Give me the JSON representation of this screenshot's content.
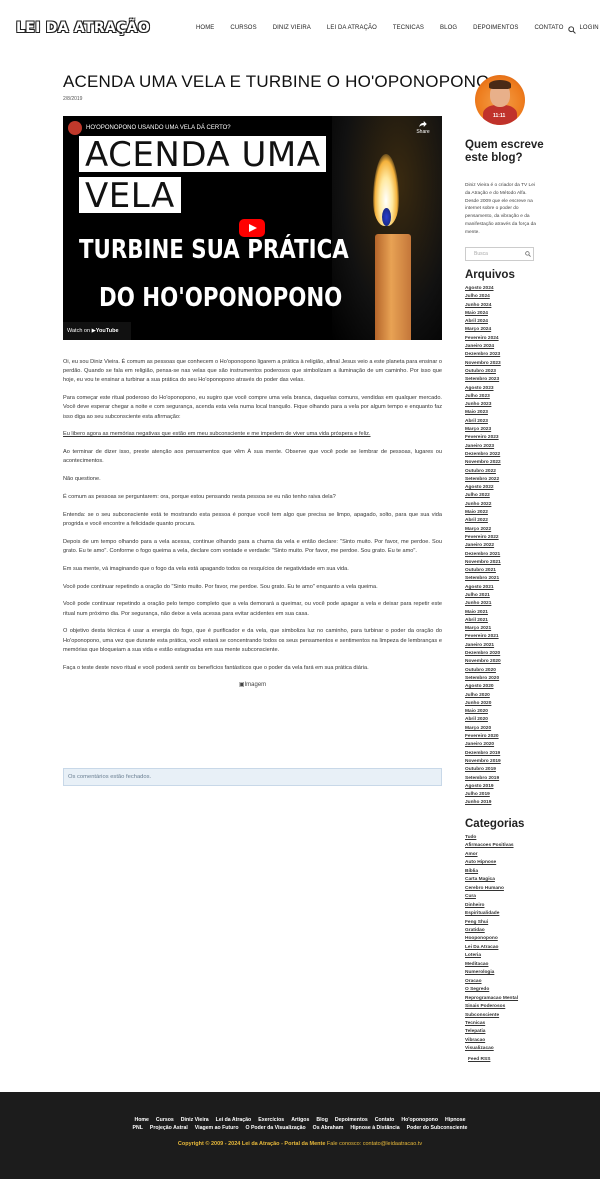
{
  "header": {
    "logo": "LEI DA ATRAÇÃO",
    "nav": [
      "HOME",
      "CURSOS",
      "DINIZ VIEIRA",
      "LEI DA ATRAÇÃO",
      "TECNICAS",
      "BLOG",
      "DEPOIMENTOS",
      "CONTATO",
      "LOGIN"
    ]
  },
  "post": {
    "title": "ACENDA UMA VELA E TURBINE O HO'OPONOPONO",
    "date": "2/8/2019"
  },
  "video": {
    "title": "HO'OPONOPONO USANDO UMA VELA DÁ CERTO?",
    "share": "Share",
    "line1": "ACENDA UMA",
    "line2": "VELA",
    "line3": "TURBINE SUA PRÁTICA",
    "line4": "DO HO'OPONOPONO",
    "watch_on": "Watch on",
    "youtube": "YouTube"
  },
  "article": {
    "paragraphs": [
      "Oi, eu sou Diniz Vieira. É comum as pessoas que conhecem o Ho'oponopono ligarem a prática à religião, afinal Jesus veio a este planeta para ensinar o perdão. Quando se fala em religião, pensa-se nas velas que são instrumentos poderosos que simbolizam a iluminação de um caminho. Por isso que hoje, eu vou te ensinar a turbinar a sua prática do seu Ho'oponopono através do poder das velas.",
      "Para começar este ritual poderoso do Ho'oponopono, eu sugiro que você compre uma vela branca, daquelas comuns, vendidas em qualquer mercado. Você deve esperar chegar a noite e com segurança, acenda esta vela numa local tranquilo. Fique olhando para a vela por algum tempo e enquanto faz isso diga ao seu subconsciente esta afirmação:",
      "Eu libero agora as memórias negativas que estão em meu subconsciente e me impedem de viver uma vida próspera e feliz.",
      "Ao terminar de dizer isso, preste atenção aos pensamentos que vêm À sua mente. Observe que você pode se lembrar de pessoas, lugares ou acontecimentos.",
      "Não questione.",
      "É comum as pessoas se perguntarem: ora, porque estou pensando nesta pessoa se eu não tenho raiva dela?",
      "Entenda: se o seu subconsciente está te mostrando esta pessoa é porque você tem algo que precisa se limpo, apagado, solto, para que sua vida progrida e você encontre a felicidade quanto procura.",
      "Depois de um tempo olhando para a vela acessa, continue olhando para a chama da vela e então declare: \"Sinto muito. Por favor, me perdoe. Sou grato. Eu te amo\". Conforme o fogo queima a vela, declare com vontade e verdade: \"Sinto muito. Por favor, me perdoe. Sou grato. Eu te amo\".",
      "Em sua mente, vá imaginando que o fogo da vela está apagando todos os resquícios de negatividade em sua vida.",
      "Você pode continuar repetindo a oração do \"Sinto muito. Por favor, me perdoe. Sou grato. Eu te amo\" enquanto a vela queima.",
      "Você pode continuar repetindo a oração pelo tempo completo que a vela demorará a queimar, ou você pode apagar a vela e deixar para repetir este ritual num próximo dia. Por segurança, não deixe a vela acessa para evitar acidentes em sua casa.",
      "O objetivo desta técnica é usar a energia do fogo, que é purificador e da vela, que simboliza luz no caminho, para turbinar o poder da oração do Ho'oponopono, uma vez que durante esta prática, você estará se concentrando todos os seus pensamentos e sentimentos na limpeza de lembranças e memórias que bloqueiam a sua vida e estão estagnadas em sua mente subconsciente.",
      "Faça o teste deste novo ritual e você poderá sentir os benefícios fantásticos que o poder da vela fará em sua prática diária."
    ],
    "image_alt": "Imagem",
    "comments_closed": "Os comentários estão fechados."
  },
  "sidebar": {
    "author_heading": "Quem escreve este blog?",
    "author_badge": "11:11",
    "bio": "Diniz Vieira é o criador da TV Lei da Atração e do Método Alfa. Desde 2009 que ele escreve na internet sobre o poder do pensamento, da vibração e da manifestação através da força da mente.",
    "search_placeholder": "Busca",
    "archives_heading": "Arquivos",
    "archives": [
      "Agosto 2024",
      "Julho 2024",
      "Junho 2024",
      "Maio 2024",
      "Abril 2024",
      "Março 2024",
      "Fevereiro 2024",
      "Janeiro 2024",
      "Dezembro 2023",
      "Novembro 2023",
      "Outubro 2023",
      "Setembro 2023",
      "Agosto 2023",
      "Julho 2023",
      "Junho 2023",
      "Maio 2023",
      "Abril 2023",
      "Março 2023",
      "Fevereiro 2023",
      "Janeiro 2023",
      "Dezembro 2022",
      "Novembro 2022",
      "Outubro 2022",
      "Setembro 2022",
      "Agosto 2022",
      "Julho 2022",
      "Junho 2022",
      "Maio 2022",
      "Abril 2022",
      "Março 2022",
      "Fevereiro 2022",
      "Janeiro 2022",
      "Dezembro 2021",
      "Novembro 2021",
      "Outubro 2021",
      "Setembro 2021",
      "Agosto 2021",
      "Julho 2021",
      "Junho 2021",
      "Maio 2021",
      "Abril 2021",
      "Março 2021",
      "Fevereiro 2021",
      "Janeiro 2021",
      "Dezembro 2020",
      "Novembro 2020",
      "Outubro 2020",
      "Setembro 2020",
      "Agosto 2020",
      "Julho 2020",
      "Junho 2020",
      "Maio 2020",
      "Abril 2020",
      "Março 2020",
      "Fevereiro 2020",
      "Janeiro 2020",
      "Dezembro 2019",
      "Novembro 2019",
      "Outubro 2019",
      "Setembro 2019",
      "Agosto 2019",
      "Julho 2019",
      "Junho 2019"
    ],
    "categories_heading": "Categorias",
    "categories": [
      "Tudo",
      "Afirmacoes Positivas",
      "Amor",
      "Auto Hipnose",
      "Bíblia",
      "Carta Magica",
      "Cerebro Humano",
      "Cura",
      "Dinheiro",
      "Espiritualidade",
      "Feng Shui",
      "Gratidao",
      "Hooponopono",
      "Lei Da Atracao",
      "Loteria",
      "Meditacao",
      "Numerologia",
      "Oracao",
      "O Segredo",
      "Reprogramacao Mental",
      "Sinais Poderosos",
      "Subconsciente",
      "Tecnicas",
      "Telepatia",
      "Vibracao",
      "Visualizacao"
    ],
    "feed": "Feed RSS"
  },
  "footer": {
    "row1": [
      "Home",
      "Cursos",
      "Diniz Vieira",
      "Lei da Atração",
      "Exercícios",
      "Artigos",
      "Blog",
      "Depoimentos",
      "Contato",
      "Ho'oponopono",
      "Hipnose"
    ],
    "row2": [
      "PNL",
      "Projeção Astral",
      "Viagem ao Futuro",
      "O Poder da Visualização",
      "Os Abraham",
      "Hipnose à Distância",
      "Poder do Subconsciente"
    ],
    "copyright": "Copyright © 2009 - 2024 Lei da Atração - Portal da Mente",
    "contact_label": "Fale conosco:",
    "contact_email": "contato@leidaatracao.tv"
  },
  "colors": {
    "footer_bg": "#1c1c1c",
    "copyright": "#e8b93a",
    "comments_bg": "#e8f0f7",
    "youtube_red": "#ff0000"
  }
}
